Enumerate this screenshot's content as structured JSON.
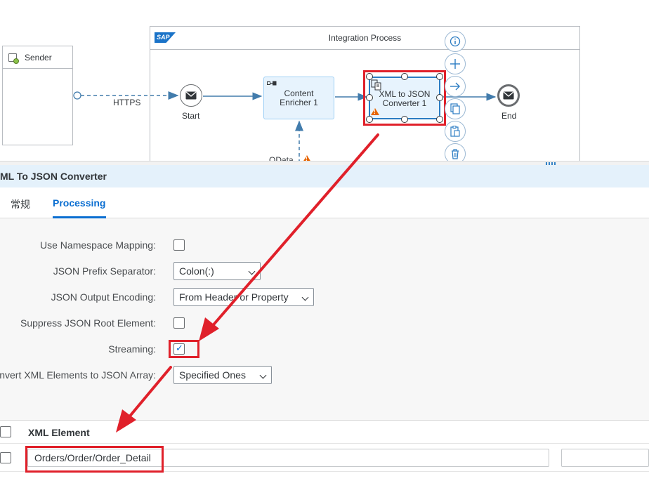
{
  "canvas": {
    "pool_title": "Integration Process",
    "sap_logo_text": "SAP",
    "sender_label": "Sender",
    "https_label": "HTTPS",
    "odata_label": "OData",
    "start_label": "Start",
    "end_label": "End",
    "enricher_label_1": "Content",
    "enricher_label_2": "Enricher 1",
    "converter_label_1": "XML to JSON",
    "converter_label_2": "Converter 1",
    "palette_icons": [
      "info-icon",
      "add-icon",
      "connect-arrow-icon",
      "copy-icon",
      "paste-icon",
      "delete-icon"
    ]
  },
  "panel": {
    "title": "ML To JSON Converter",
    "tabs": [
      {
        "label": "常规",
        "active": false
      },
      {
        "label": "Processing",
        "active": true
      }
    ]
  },
  "form": {
    "use_namespace_mapping": {
      "label": "Use Namespace Mapping:",
      "checked": false
    },
    "json_prefix_separator": {
      "label": "JSON Prefix Separator:",
      "value": "Colon(:)"
    },
    "json_output_encoding": {
      "label": "JSON Output Encoding:",
      "value": "From Header or Property"
    },
    "suppress_json_root": {
      "label": "Suppress JSON Root Element:",
      "checked": false
    },
    "streaming": {
      "label": "Streaming:",
      "checked": true
    },
    "convert_to_array": {
      "label": "onvert XML Elements to JSON Array:",
      "value": "Specified Ones"
    }
  },
  "table": {
    "header_label": "XML Element",
    "rows": [
      {
        "value": "Orders/Order/Order_Detail"
      }
    ]
  },
  "colors": {
    "highlight": "#e0202a",
    "accent": "#0a6ed1",
    "warning": "#e76500"
  }
}
